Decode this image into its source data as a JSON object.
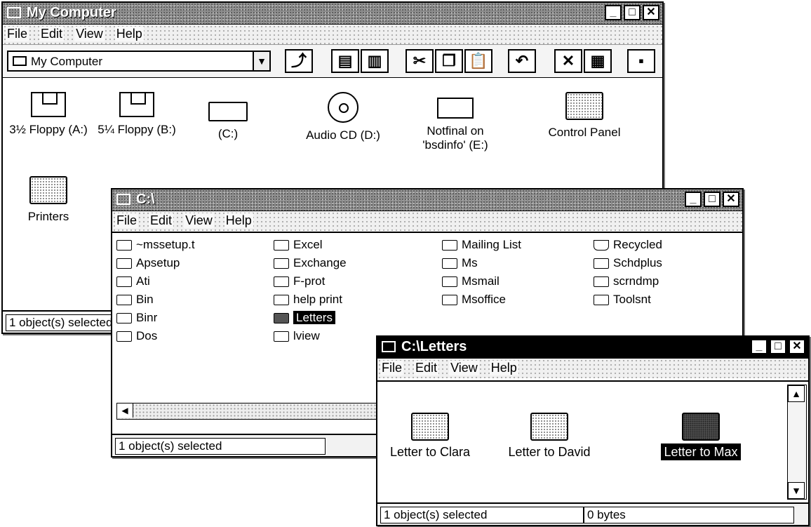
{
  "mycomputer": {
    "title": "My Computer",
    "menu": [
      "File",
      "Edit",
      "View",
      "Help"
    ],
    "address": "My Computer",
    "toolbar_icons": [
      "up-folder-icon",
      "map-drive-icon",
      "disconnect-icon",
      "cut-icon",
      "copy-icon",
      "paste-icon",
      "undo-icon",
      "delete-icon",
      "properties-icon",
      "view-icon"
    ],
    "items": [
      {
        "label": "3½ Floppy (A:)",
        "icon": "floppy-drive-icon"
      },
      {
        "label": "5¼ Floppy (B:)",
        "icon": "floppy-drive-icon"
      },
      {
        "label": "(C:)",
        "icon": "hard-drive-icon"
      },
      {
        "label": "Audio CD (D:)",
        "icon": "cd-icon"
      },
      {
        "label": "Notfinal on 'bsdinfo' (E:)",
        "icon": "network-drive-icon"
      },
      {
        "label": "Control Panel",
        "icon": "control-panel-icon"
      },
      {
        "label": "Printers",
        "icon": "printers-icon"
      }
    ],
    "status": "1 object(s) selected"
  },
  "cwin": {
    "title": "C:\\",
    "menu": [
      "File",
      "Edit",
      "View",
      "Help"
    ],
    "col1": [
      "~mssetup.t",
      "Apsetup",
      "Ati",
      "Bin",
      "Binr",
      "Dos"
    ],
    "col2": [
      "Excel",
      "Exchange",
      "F-prot",
      "help print",
      "Letters",
      "lview"
    ],
    "col3": [
      "Mailing List",
      "Ms",
      "Msmail",
      "Msoffice"
    ],
    "col4": [
      "Recycled",
      "Schdplus",
      "scrndmp",
      "Toolsnt"
    ],
    "selected": "Letters",
    "status": "1 object(s) selected"
  },
  "letters": {
    "title": "C:\\Letters",
    "menu": [
      "File",
      "Edit",
      "View",
      "Help"
    ],
    "items": [
      "Letter to Clara",
      "Letter to David",
      "Letter to Max"
    ],
    "selected": "Letter to Max",
    "status": "1 object(s) selected",
    "size": "0 bytes"
  }
}
